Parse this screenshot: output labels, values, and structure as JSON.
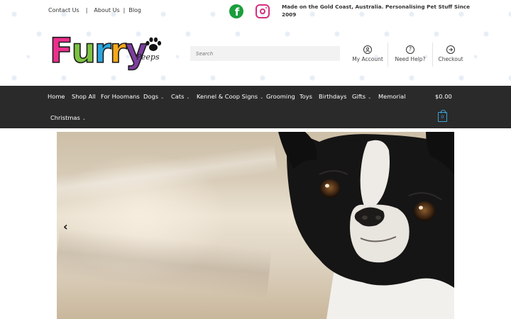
{
  "topbar": {
    "links": [
      {
        "label": "Contact Us"
      },
      {
        "label": "About Us"
      },
      {
        "label": "Blog"
      }
    ],
    "separators": [
      "|",
      "|"
    ]
  },
  "social": {
    "facebook_icon": "facebook-icon",
    "instagram_icon": "instagram-icon"
  },
  "tagline": "Made on the Gold Coast, Australia. Personalising Pet Stuff Since 2009",
  "logo": {
    "text": "Furry",
    "subtext": "Peeps",
    "letter_colors": [
      "#ec2f8c",
      "#7cc242",
      "#2aa6df",
      "#f6a81b",
      "#7c3f9e"
    ]
  },
  "search": {
    "placeholder": "Search",
    "value": ""
  },
  "header_links": [
    {
      "label": "My Account",
      "icon": "user-icon"
    },
    {
      "label": "Need Help?",
      "icon": "help-icon"
    },
    {
      "label": "Checkout",
      "icon": "arrow-right-icon"
    }
  ],
  "nav": {
    "items": [
      {
        "label": "Home",
        "dropdown": false
      },
      {
        "label": "Shop All",
        "dropdown": false
      },
      {
        "label": "For Hoomans",
        "dropdown": false
      },
      {
        "label": "Dogs",
        "dropdown": true
      },
      {
        "label": "Cats",
        "dropdown": true
      },
      {
        "label": "Kennel & Coop Signs",
        "dropdown": true
      },
      {
        "label": "Grooming",
        "dropdown": false
      },
      {
        "label": "Toys",
        "dropdown": false
      },
      {
        "label": "Birthdays",
        "dropdown": false
      },
      {
        "label": "Gifts",
        "dropdown": true
      },
      {
        "label": "Memorial",
        "dropdown": false
      },
      {
        "label": "Christmas",
        "dropdown": true
      }
    ],
    "cart_total": "$0.00",
    "cart_count": "0"
  },
  "hero": {
    "prev_icon": "chevron-left-icon",
    "image": "french-bulldog-photo"
  },
  "colors": {
    "nav_bg": "#2a2a2a",
    "accent": "#3aa3d6",
    "facebook": "#1a9e3c",
    "instagram": "#d62f7e"
  }
}
